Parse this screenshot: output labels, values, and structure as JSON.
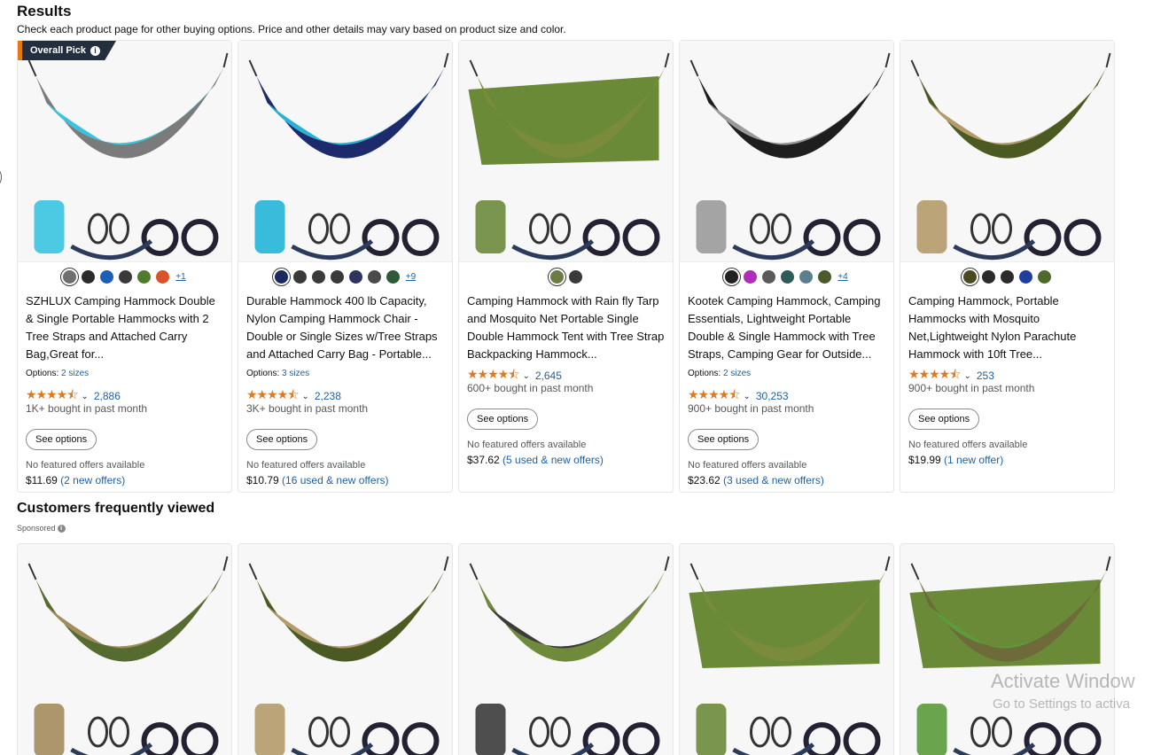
{
  "header": {
    "title": "Results",
    "subtitle": "Check each product page for other buying options. Price and other details may vary based on product size and color."
  },
  "badge": {
    "label": "Overall Pick",
    "info": "i"
  },
  "products": [
    {
      "title": "SZHLUX Camping Hammock Double & Single Portable Hammocks with 2 Tree Straps and Attached Carry Bag,Great for...",
      "swatches": [
        "#6f6f6f",
        "#2b2b2b",
        "#1f5fb3",
        "#3a3a3a",
        "#4d7d2b",
        "#d9532a"
      ],
      "selected": 0,
      "more": "+1",
      "options_label": "Options:",
      "options_value": "2 sizes",
      "stars": "★★★★⯪",
      "rating_count": "2,886",
      "bought": "1K+ bought in past month",
      "button": "See options",
      "no_featured": "No featured offers available",
      "price": "$11.69",
      "offers": "(2 new offers)",
      "hammock": [
        "#38c4e0",
        "#7b7b7b"
      ]
    },
    {
      "title": "Durable Hammock 400 lb Capacity, Nylon Camping Hammock Chair - Double or Single Sizes w/Tree Straps and Attached Carry Bag - Portable...",
      "swatches": [
        "#1b2a5e",
        "#3a3a3a",
        "#3a3a3a",
        "#3a3a3a",
        "#2e3560",
        "#4a4a4a",
        "#2f5a3a"
      ],
      "selected": 0,
      "more": "+9",
      "options_label": "Options:",
      "options_value": "3 sizes",
      "stars": "★★★★⯪",
      "rating_count": "2,238",
      "bought": "3K+ bought in past month",
      "button": "See options",
      "no_featured": "No featured offers available",
      "price": "$10.79",
      "offers": "(16 used & new offers)",
      "hammock": [
        "#24b4d8",
        "#1d2a6b"
      ]
    },
    {
      "title": "Camping Hammock with Rain fly Tarp and Mosquito Net Portable Single Double Hammock Tent with Tree Strap Backpacking Hammock...",
      "swatches": [
        "#6b7d45",
        "#3a3a3a"
      ],
      "selected": 0,
      "more": "",
      "options_label": "",
      "options_value": "",
      "stars": "★★★★⯪",
      "rating_count": "2,645",
      "bought": "600+ bought in past month",
      "button": "See options",
      "no_featured": "No featured offers available",
      "price": "$37.62",
      "offers": "(5 used & new offers)",
      "hammock": [
        "#6b8a3a",
        "#7a8c3c"
      ]
    },
    {
      "title": "Kootek Camping Hammock, Camping Essentials, Lightweight Portable Double & Single Hammock with Tree Straps, Camping Gear for Outside...",
      "swatches": [
        "#222222",
        "#b02cb9",
        "#5a5a5a",
        "#2f5a5a",
        "#5b7f8f",
        "#4a5a2a"
      ],
      "selected": 0,
      "more": "+4",
      "options_label": "Options:",
      "options_value": "2 sizes",
      "stars": "★★★★⯪",
      "rating_count": "30,253",
      "bought": "900+ bought in past month",
      "button": "See options",
      "no_featured": "No featured offers available",
      "price": "$23.62",
      "offers": "(3 used & new offers)",
      "hammock": [
        "#9a9a9a",
        "#1e1e1e"
      ]
    },
    {
      "title": "Camping Hammock, Portable Hammocks with Mosquito Net,Lightweight Nylon Parachute Hammock with 10ft Tree...",
      "swatches": [
        "#4a4a22",
        "#2b2b2b",
        "#2b2b2b",
        "#1f3f9f",
        "#4d6a2b"
      ],
      "selected": 0,
      "more": "",
      "options_label": "",
      "options_value": "",
      "stars": "★★★★⯪",
      "rating_count": "253",
      "bought": "900+ bought in past month",
      "button": "See options",
      "no_featured": "No featured offers available",
      "price": "$19.99",
      "offers": "(1 new offer)",
      "hammock": [
        "#b59a6a",
        "#4b5a22"
      ]
    }
  ],
  "customers_viewed": {
    "title": "Customers frequently viewed",
    "sponsored": "Sponsored",
    "sponsored_info": "i",
    "items": [
      {
        "hammock": [
          "#a58b5c",
          "#556b2f"
        ]
      },
      {
        "hammock": [
          "#b59a6a",
          "#4b5a22"
        ]
      },
      {
        "hammock": [
          "#3b3b3b",
          "#6e8a3a"
        ]
      },
      {
        "hammock": [
          "#6b8a3a",
          "#7a8c3c"
        ]
      },
      {
        "hammock": [
          "#5a9b3a",
          "#6e6a3a"
        ]
      }
    ]
  },
  "watermark": {
    "line1": "Activate Window",
    "line2": "Go to Settings to activa"
  }
}
